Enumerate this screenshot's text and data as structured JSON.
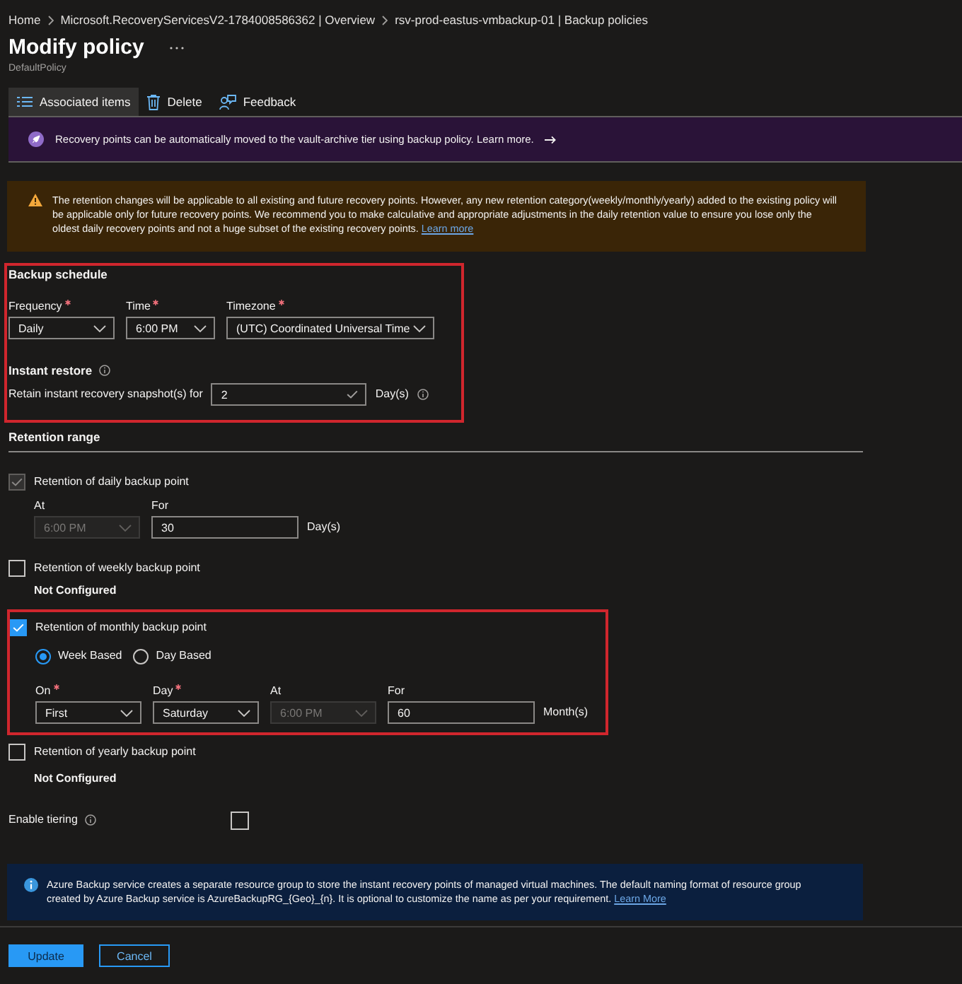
{
  "breadcrumb": [
    {
      "label": "Home"
    },
    {
      "label": "Microsoft.RecoveryServicesV2-1784008586362 | Overview"
    },
    {
      "label": "rsv-prod-eastus-vmbackup-01 | Backup policies"
    }
  ],
  "header": {
    "title": "Modify policy",
    "subtitle": "DefaultPolicy"
  },
  "toolbar": [
    {
      "label": "Associated items",
      "kind": "list",
      "selected": true
    },
    {
      "label": "Delete",
      "kind": "delete",
      "selected": false
    },
    {
      "label": "Feedback",
      "kind": "feedback",
      "selected": false
    }
  ],
  "archive_banner": {
    "text": "Recovery points can be automatically moved to the vault-archive tier using backup policy.",
    "link": "Learn more."
  },
  "warning": {
    "text": "The retention changes will be applicable to all existing and future recovery points. However, any new retention category(weekly/monthly/yearly) added to the existing policy will be applicable only for future recovery points. We recommend you to make calculative and appropriate adjustments in the daily retention value to ensure you lose only the oldest daily recovery points and not a huge subset of the existing recovery points.",
    "link": "Learn more"
  },
  "backup_schedule": {
    "title": "Backup schedule",
    "highlighted": true,
    "fields": [
      {
        "label": "Frequency",
        "required": true,
        "value": "Daily"
      },
      {
        "label": "Time",
        "required": true,
        "value": "6:00 PM"
      },
      {
        "label": "Timezone",
        "required": true,
        "value": "(UTC) Coordinated Universal Time"
      }
    ],
    "instant_restore": {
      "title": "Instant restore",
      "label": "Retain instant recovery snapshot(s) for",
      "value": "2",
      "valid": true,
      "unit": "Day(s)"
    }
  },
  "retention_range": {
    "title": "Retention range",
    "items": [
      {
        "label": "Retention of daily backup point",
        "checked": true,
        "disabled": true,
        "highlighted": false,
        "fields": [
          {
            "label": "At",
            "kind": "dropdown",
            "required": false,
            "disabled": true,
            "value": "6:00 PM"
          },
          {
            "label": "For",
            "kind": "input",
            "required": false,
            "disabled": false,
            "value": "30"
          }
        ],
        "unit": "Day(s)"
      },
      {
        "label": "Retention of weekly backup point",
        "checked": false,
        "disabled": false,
        "highlighted": false,
        "status": "Not Configured"
      },
      {
        "label": "Retention of monthly backup point",
        "checked": true,
        "disabled": false,
        "highlighted": true,
        "options": [
          {
            "label": "Week Based",
            "selected": true
          },
          {
            "label": "Day Based",
            "selected": false
          }
        ],
        "fields": [
          {
            "label": "On",
            "kind": "dropdown",
            "required": true,
            "disabled": false,
            "value": "First"
          },
          {
            "label": "Day",
            "kind": "dropdown",
            "required": true,
            "disabled": false,
            "value": "Saturday"
          },
          {
            "label": "At",
            "kind": "dropdown",
            "required": false,
            "disabled": true,
            "value": "6:00 PM"
          },
          {
            "label": "For",
            "kind": "input",
            "required": false,
            "disabled": false,
            "value": "60"
          }
        ],
        "unit": "Month(s)"
      },
      {
        "label": "Retention of yearly backup point",
        "checked": false,
        "disabled": false,
        "highlighted": false,
        "status": "Not Configured"
      }
    ]
  },
  "tiering": {
    "label": "Enable tiering",
    "checked": false
  },
  "info_banner": {
    "text": "Azure Backup service creates a separate resource group to store the instant recovery points of managed virtual machines. The default naming format of resource group created by Azure Backup service is AzureBackupRG_{Geo}_{n}. It is optional to customize the name as per your requirement.",
    "link": "Learn More"
  },
  "actions": [
    {
      "label": "Update",
      "kind": "primary"
    },
    {
      "label": "Cancel",
      "kind": "secondary"
    }
  ]
}
